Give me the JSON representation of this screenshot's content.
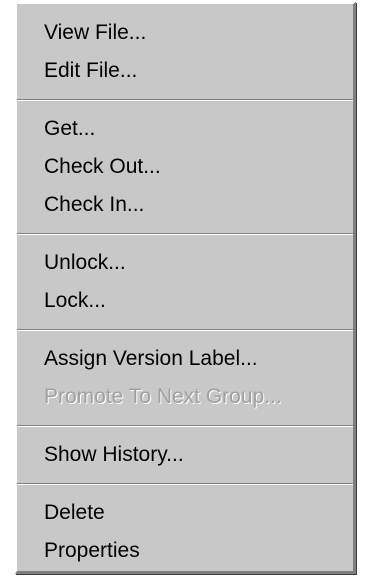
{
  "menu": {
    "groups": [
      {
        "items": [
          {
            "label": "View File...",
            "enabled": true
          },
          {
            "label": "Edit File...",
            "enabled": true
          }
        ]
      },
      {
        "items": [
          {
            "label": "Get...",
            "enabled": true
          },
          {
            "label": "Check Out...",
            "enabled": true
          },
          {
            "label": "Check In...",
            "enabled": true
          }
        ]
      },
      {
        "items": [
          {
            "label": "Unlock...",
            "enabled": true
          },
          {
            "label": "Lock...",
            "enabled": true
          }
        ]
      },
      {
        "items": [
          {
            "label": "Assign Version Label...",
            "enabled": true
          },
          {
            "label": "Promote To Next Group...",
            "enabled": false
          }
        ]
      },
      {
        "items": [
          {
            "label": "Show History...",
            "enabled": true
          }
        ]
      },
      {
        "items": [
          {
            "label": "Delete",
            "enabled": true
          },
          {
            "label": "Properties",
            "enabled": true
          }
        ]
      }
    ]
  },
  "colors": {
    "menu_background": "#c8c8c8",
    "text": "#000000",
    "disabled_text": "#a0a0a0"
  }
}
